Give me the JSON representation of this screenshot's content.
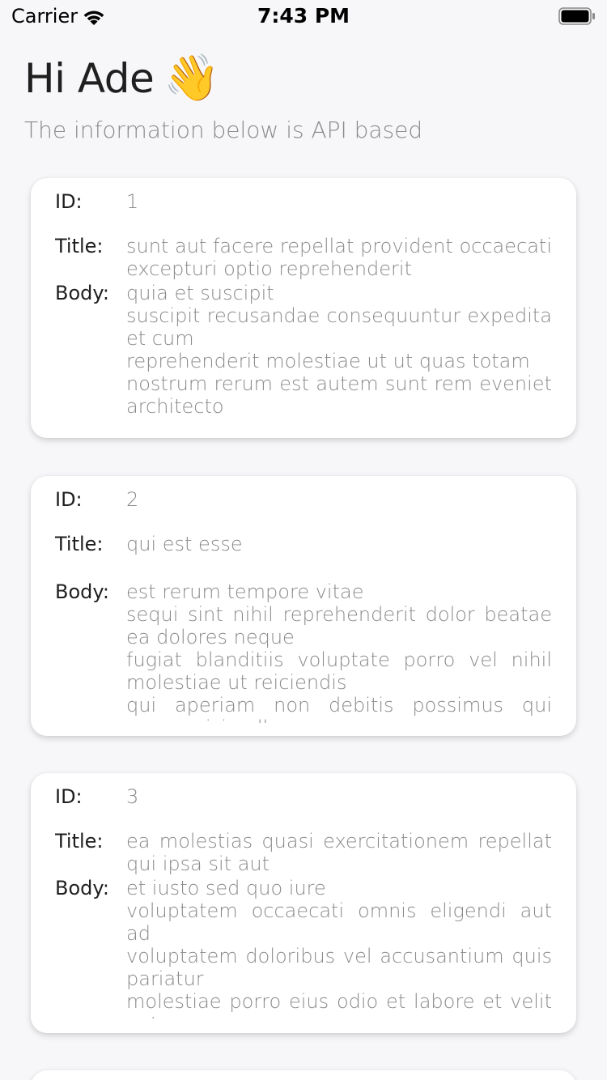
{
  "status_bar": {
    "carrier": "Carrier",
    "time": "7:43 PM"
  },
  "header": {
    "greeting": "Hi Ade",
    "emoji": "👋",
    "subtitle": "The information below is API based"
  },
  "labels": {
    "id": "ID:",
    "title": "Title:",
    "body": "Body:"
  },
  "posts": [
    {
      "id": "1",
      "title": "sunt aut facere repellat provident occaecati excepturi optio reprehenderit",
      "body": "quia et suscipit\nsuscipit recusandae consequuntur expedita et cum\nreprehenderit molestiae ut ut quas totam\nnostrum rerum est autem sunt rem eveniet architecto"
    },
    {
      "id": "2",
      "title": "qui est esse",
      "body": "est rerum tempore vitae\nsequi sint nihil reprehenderit dolor beatae ea dolores neque\nfugiat blanditiis voluptate porro vel nihil molestiae ut reiciendis\nqui aperiam non debitis possimus qui neque nisi nulla"
    },
    {
      "id": "3",
      "title": "ea molestias quasi exercitationem repellat qui ipsa sit aut",
      "body": "et iusto sed quo iure\nvoluptatem occaecati omnis eligendi aut ad\nvoluptatem doloribus vel accusantium quis pariatur\nmolestiae porro eius odio et labore et velit aut"
    }
  ],
  "colors": {
    "background": "#f7f7f9",
    "card": "#ffffff",
    "label_text": "#1e1e1e",
    "value_text": "#8a8a8a"
  }
}
